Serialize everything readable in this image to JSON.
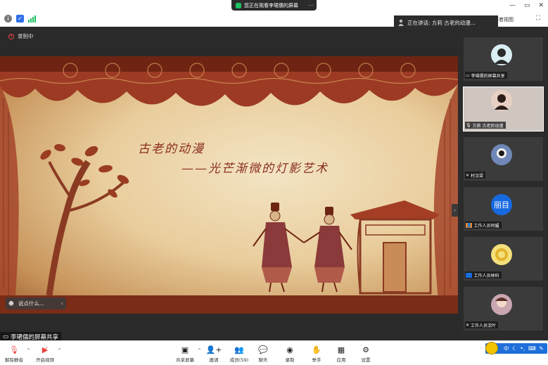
{
  "titlebar": {
    "sharing_text": "您正在观看李珺儒的屏幕",
    "speaker_view_label": "讲者视图",
    "win_controls": [
      "—",
      "▭",
      "✕"
    ]
  },
  "speaking_bar": {
    "label": "正在讲话: 方莉 古老的动漫..."
  },
  "share": {
    "recording_label": "录制中",
    "slide_title": "古老的动漫",
    "slide_subtitle": "——光芒渐微的灯影艺术",
    "chat_placeholder": "说点什么...",
    "sharer_label": "李珺儒的屏幕共享"
  },
  "participants": [
    {
      "name": "李珺儒的屏幕共享",
      "avatar_color": "#d9eef2",
      "avatar_text": ""
    },
    {
      "name": "方莉 古老的动漫",
      "avatar_color": "#e8d0c4",
      "avatar_text": ""
    },
    {
      "name": "村汉梁",
      "avatar_color": "#6f88b8",
      "avatar_text": ""
    },
    {
      "name": "工作人员阿媚",
      "avatar_color": "#1769e0",
      "avatar_text": "丽目"
    },
    {
      "name": "工作人员林科",
      "avatar_color": "#f4df7a",
      "avatar_text": ""
    },
    {
      "name": "工作人员沈叶",
      "avatar_color": "#c9a6b0",
      "avatar_text": ""
    }
  ],
  "toolbar": {
    "unmute": "解除静音",
    "start_video": "开启视频",
    "share_screen": "共享屏幕",
    "invite": "邀请",
    "members": "成员(59)",
    "chat": "聊天",
    "record": "录制",
    "raise_hand": "举手",
    "apps": "应用",
    "settings": "设置"
  },
  "ime": {
    "lang": "中"
  },
  "colors": {
    "accent": "#1769e0",
    "slide_text": "#8a2d1f",
    "record_red": "#e8463f"
  }
}
